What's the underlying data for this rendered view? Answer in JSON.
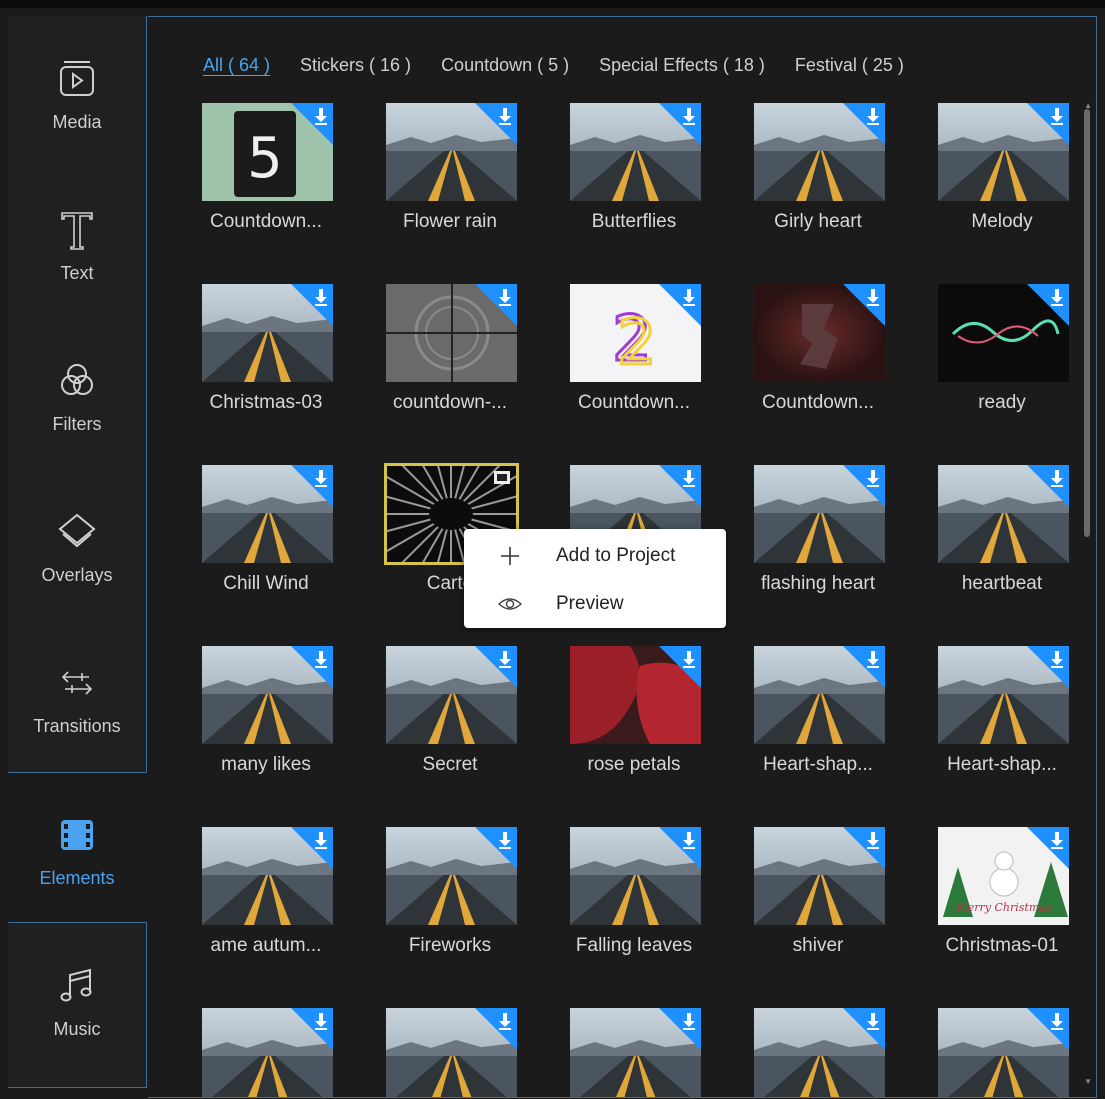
{
  "sidebar": {
    "items": [
      {
        "label": "Media",
        "icon": "media-icon"
      },
      {
        "label": "Text",
        "icon": "text-icon"
      },
      {
        "label": "Filters",
        "icon": "filters-icon"
      },
      {
        "label": "Overlays",
        "icon": "overlays-icon"
      },
      {
        "label": "Transitions",
        "icon": "transitions-icon"
      },
      {
        "label": "Elements",
        "icon": "elements-icon",
        "active": true
      },
      {
        "label": "Music",
        "icon": "music-icon"
      }
    ]
  },
  "tabs": [
    {
      "label": "All ( 64 )",
      "active": true
    },
    {
      "label": "Stickers ( 16 )"
    },
    {
      "label": "Countdown ( 5 )"
    },
    {
      "label": "Special Effects ( 18 )"
    },
    {
      "label": "Festival ( 25 )"
    }
  ],
  "elements": [
    {
      "title": "Countdown...",
      "thumb": "countdown5",
      "download": true
    },
    {
      "title": "Flower rain",
      "thumb": "road",
      "download": true
    },
    {
      "title": "Butterflies",
      "thumb": "road",
      "download": true
    },
    {
      "title": "Girly heart",
      "thumb": "road",
      "download": true
    },
    {
      "title": "Melody",
      "thumb": "road",
      "download": true
    },
    {
      "title": "Christmas-03",
      "thumb": "road",
      "download": true
    },
    {
      "title": "countdown-...",
      "thumb": "film3",
      "download": true
    },
    {
      "title": "Countdown...",
      "thumb": "neon2",
      "download": true
    },
    {
      "title": "Countdown...",
      "thumb": "red3",
      "download": true
    },
    {
      "title": "ready",
      "thumb": "black",
      "download": true
    },
    {
      "title": "Chill Wind",
      "thumb": "road",
      "download": true
    },
    {
      "title": "Carto",
      "thumb": "cartoon",
      "download": false,
      "selected": true
    },
    {
      "title": "",
      "thumb": "road",
      "download": true
    },
    {
      "title": "flashing heart",
      "thumb": "road",
      "download": true
    },
    {
      "title": "heartbeat",
      "thumb": "road",
      "download": true
    },
    {
      "title": "many likes",
      "thumb": "road",
      "download": true
    },
    {
      "title": "Secret",
      "thumb": "road",
      "download": true
    },
    {
      "title": "rose petals",
      "thumb": "rose",
      "download": true
    },
    {
      "title": "Heart-shap...",
      "thumb": "road",
      "download": true
    },
    {
      "title": "Heart-shap...",
      "thumb": "road",
      "download": true
    },
    {
      "title": "ame autum...",
      "thumb": "road",
      "download": true
    },
    {
      "title": "Fireworks",
      "thumb": "road",
      "download": true
    },
    {
      "title": "Falling leaves",
      "thumb": "road",
      "download": true
    },
    {
      "title": "shiver",
      "thumb": "road",
      "download": true
    },
    {
      "title": "Christmas-01",
      "thumb": "xmas",
      "download": true
    },
    {
      "title": "",
      "thumb": "road",
      "download": true
    },
    {
      "title": "",
      "thumb": "road",
      "download": true
    },
    {
      "title": "",
      "thumb": "road",
      "download": true
    },
    {
      "title": "",
      "thumb": "road",
      "download": true
    },
    {
      "title": "",
      "thumb": "road",
      "download": true
    }
  ],
  "thumb_text": {
    "countdown5": "5",
    "neon2": "2",
    "xmas": "Merry Christmas"
  },
  "context_menu": {
    "items": [
      {
        "label": "Add to Project",
        "icon": "plus-icon"
      },
      {
        "label": "Preview",
        "icon": "eye-icon"
      }
    ]
  },
  "colors": {
    "accent": "#4aa3f0",
    "download_badge": "#1e90ff",
    "selection": "#d6c34a"
  }
}
